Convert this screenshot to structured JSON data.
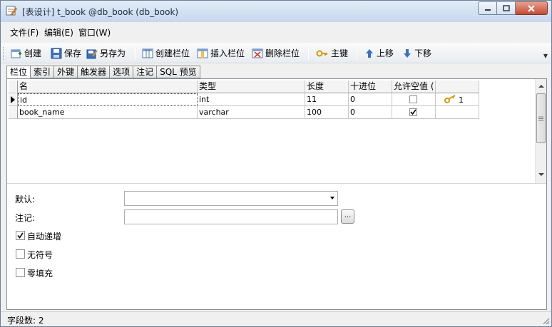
{
  "window": {
    "title": "[表设计] t_book @db_book (db_book)",
    "accent": "#c44a32"
  },
  "menu": [
    "文件(F)",
    "编辑(E)",
    "窗口(W)"
  ],
  "toolbar": {
    "create": "创建",
    "save": "保存",
    "save_as": "另存为",
    "create_column": "创建栏位",
    "insert_column": "插入栏位",
    "delete_column": "删除栏位",
    "primary_key": "主键",
    "move_up": "上移",
    "move_down": "下移"
  },
  "tabs": [
    "栏位",
    "索引",
    "外键",
    "触发器",
    "选项",
    "注记",
    "SQL 预览"
  ],
  "grid": {
    "columns": [
      "名",
      "类型",
      "长度",
      "十进位",
      "允许空值 (",
      ""
    ],
    "rows": [
      {
        "name": "id",
        "type": "int",
        "length": "11",
        "decimal": "0",
        "nullable": false,
        "key": "1",
        "selected": true
      },
      {
        "name": "book_name",
        "type": "varchar",
        "length": "100",
        "decimal": "0",
        "nullable": true,
        "key": "",
        "selected": false
      }
    ]
  },
  "properties": {
    "default_label": "默认:",
    "default_value": "",
    "comment_label": "注记:",
    "comment_value": "",
    "ellipsis_label": "...",
    "auto_increment_label": "自动递增",
    "auto_increment": true,
    "unsigned_label": "无符号",
    "unsigned": false,
    "zerofill_label": "零填充",
    "zerofill": false
  },
  "status": {
    "field_count": "字段数: 2"
  }
}
